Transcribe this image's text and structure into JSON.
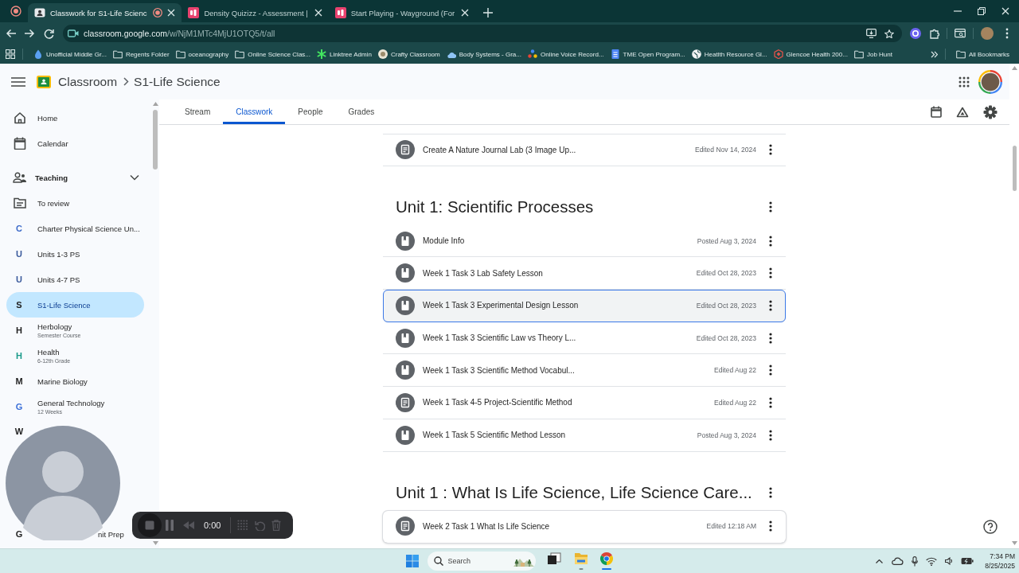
{
  "browser": {
    "tabs": [
      {
        "title": "Classwork for S1-Life Scienc",
        "kind": "classroom",
        "selected": true,
        "recording": true
      },
      {
        "title": "Density Quizizz - Assessment |",
        "kind": "quiz",
        "selected": false,
        "recording": false
      },
      {
        "title": "Start Playing - Wayground (For",
        "kind": "quiz",
        "selected": false,
        "recording": false
      }
    ],
    "address": {
      "domain": "classroom.google.com",
      "path": "/w/NjM1MTc4MjU1OTQ5/t/all"
    },
    "bookmarks": [
      {
        "label": "Unofficial Middle Gr...",
        "kind": "drop"
      },
      {
        "label": "Regents Folder",
        "kind": "folder"
      },
      {
        "label": "oceanography",
        "kind": "folder"
      },
      {
        "label": "Online Science Clas...",
        "kind": "folder"
      },
      {
        "label": "Linktree Admin",
        "kind": "asterisk"
      },
      {
        "label": "Crafty Classroom",
        "kind": "badge"
      },
      {
        "label": "Body Systems - Gra...",
        "kind": "cloud"
      },
      {
        "label": "Online Voice Record...",
        "kind": "dots"
      },
      {
        "label": "TME Open Program...",
        "kind": "doc"
      },
      {
        "label": "Heatlth Resource Gl...",
        "kind": "globe"
      },
      {
        "label": "Glencoe Health 200...",
        "kind": "hexagon"
      },
      {
        "label": "Job Hunt",
        "kind": "folder"
      }
    ],
    "all_bookmarks": "All Bookmarks"
  },
  "classroom": {
    "app_name": "Classroom",
    "course": "S1-Life Science",
    "sidebar": [
      {
        "kind": "home",
        "label": "Home",
        "selected": false
      },
      {
        "kind": "calendar",
        "label": "Calendar",
        "selected": false
      },
      {
        "kind": "teaching",
        "label": "Teaching",
        "expanded": true,
        "selected": false
      },
      {
        "kind": "review",
        "label": "To review",
        "selected": false
      },
      {
        "kind": "course",
        "letter": "C",
        "label": "Charter Physical Science Un...",
        "color": "#3d6bc9",
        "selected": false
      },
      {
        "kind": "course",
        "letter": "U",
        "label": "Units 1-3 PS",
        "color": "#3a5a9c",
        "selected": false
      },
      {
        "kind": "course",
        "letter": "U",
        "label": "Units 4-7 PS",
        "color": "#3a5a9c",
        "selected": false
      },
      {
        "kind": "course",
        "letter": "S",
        "label": "S1-Life Science",
        "color": "#1f1f1f",
        "selected": true
      },
      {
        "kind": "course",
        "letter": "H",
        "label": "Herbology",
        "subtitle": "Semester Course",
        "color": "#1f1f1f",
        "selected": false
      },
      {
        "kind": "course",
        "letter": "H",
        "label": "Health",
        "subtitle": "6-12th Grade",
        "color": "#1a9a8a",
        "selected": false
      },
      {
        "kind": "course",
        "letter": "M",
        "label": "Marine Biology",
        "color": "#1f1f1f",
        "selected": false
      },
      {
        "kind": "course",
        "letter": "G",
        "label": "General Technology",
        "subtitle": "12 Weeks",
        "color": "#3a6fd8",
        "selected": false
      },
      {
        "kind": "course",
        "letter": "W",
        "color": "#1f1f1f",
        "selected": false
      },
      {
        "kind": "course",
        "letter": "G",
        "label": "nit Prep",
        "color": "#1f1f1f",
        "selected": false
      }
    ],
    "tabs": [
      {
        "label": "Stream",
        "selected": false
      },
      {
        "label": "Classwork",
        "selected": true
      },
      {
        "label": "People",
        "selected": false
      },
      {
        "label": "Grades",
        "selected": false
      }
    ],
    "sections": [
      {
        "items": [
          {
            "title": "Create A Nature Journal Lab (3 Image Up...",
            "status": "Edited Nov 14, 2024",
            "kind": "assignment",
            "selected": false,
            "hovered": false
          }
        ]
      },
      {
        "heading": "Unit 1: Scientific Processes",
        "items": [
          {
            "title": "Module Info",
            "status": "Posted Aug 3, 2024",
            "kind": "material",
            "selected": false,
            "hovered": false
          },
          {
            "title": "Week 1 Task 3 Lab Safety Lesson",
            "status": "Edited Oct 28, 2023",
            "kind": "material",
            "selected": false,
            "hovered": false
          },
          {
            "title": "Week 1 Task 3 Experimental Design Lesson",
            "status": "Edited Oct 28, 2023",
            "kind": "material",
            "selected": true,
            "hovered": false
          },
          {
            "title": "Week 1 Task 3 Scientific Law vs Theory L...",
            "status": "Edited Oct 28, 2023",
            "kind": "material",
            "selected": false,
            "hovered": false
          },
          {
            "title": "Week 1 Task 3 Scientific Method Vocabul...",
            "status": "Edited Aug 22",
            "kind": "material",
            "selected": false,
            "hovered": false
          },
          {
            "title": "Week 1 Task 4-5 Project-Scientific Method",
            "status": "Edited Aug 22",
            "kind": "assignment",
            "selected": false,
            "hovered": false
          },
          {
            "title": "Week 1 Task 5 Scientific Method Lesson",
            "status": "Posted Aug 3, 2024",
            "kind": "material",
            "selected": false,
            "hovered": false
          }
        ]
      },
      {
        "heading": "Unit 1 : What Is Life Science, Life Science Care...",
        "items": [
          {
            "title": "Week 2 Task 1 What Is Life Science",
            "status": "Edited 12:18 AM",
            "kind": "assignment",
            "selected": false,
            "hovered": true
          }
        ]
      }
    ]
  },
  "recorder": {
    "time": "0:00"
  },
  "taskbar": {
    "search_label": "Search",
    "apps": [
      {
        "kind": "taskview",
        "running": false,
        "active": false
      },
      {
        "kind": "explorer",
        "running": true,
        "active": false
      },
      {
        "kind": "chrome",
        "running": true,
        "active": true
      }
    ],
    "time": "7:34 PM",
    "date": "8/25/2025"
  }
}
